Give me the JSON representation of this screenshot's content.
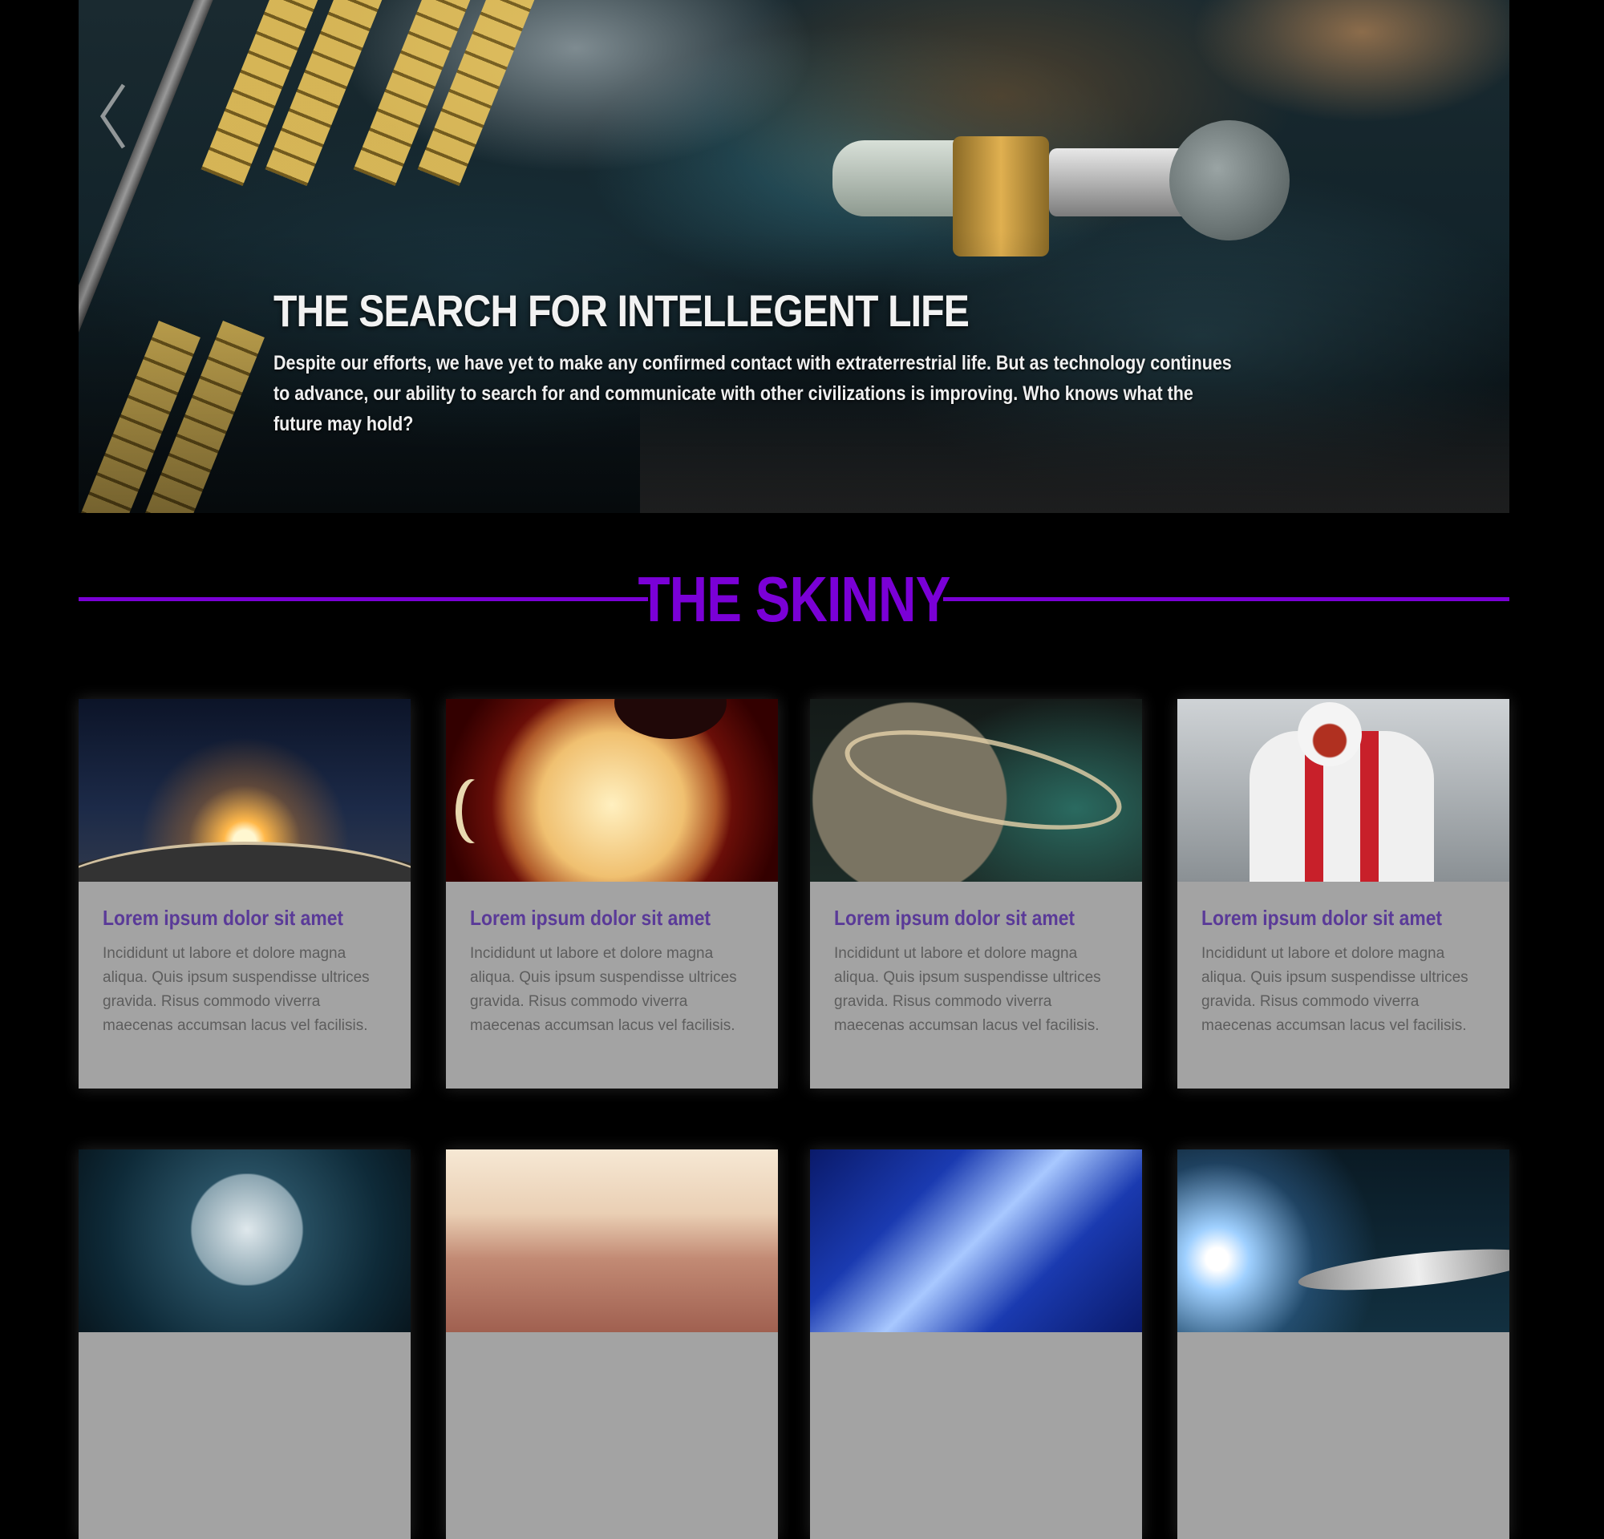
{
  "hero": {
    "title": "THE SEARCH FOR INTELLEGENT LIFE",
    "text": "Despite our efforts, we have yet to make any confirmed contact with extraterrestrial life. But as technology continues to advance, our ability to search for and communicate with other civilizations is improving. Who knows what the future may hold?",
    "prev_icon": "chevron-left-icon"
  },
  "section": {
    "title": "THE SKINNY",
    "accent_color": "#7a00d6"
  },
  "cards": [
    {
      "title": "Lorem ipsum dolor sit amet",
      "text": "Incididunt ut labore et dolore magna aliqua. Quis ipsum suspendisse ultrices gravida. Risus commodo viverra maecenas accumsan lacus vel facilisis."
    },
    {
      "title": "Lorem ipsum dolor sit amet",
      "text": "Incididunt ut labore et dolore magna aliqua. Quis ipsum suspendisse ultrices gravida. Risus commodo viverra maecenas accumsan lacus vel facilisis."
    },
    {
      "title": "Lorem ipsum dolor sit amet",
      "text": "Incididunt ut labore et dolore magna aliqua. Quis ipsum suspendisse ultrices gravida. Risus commodo viverra maecenas accumsan lacus vel facilisis."
    },
    {
      "title": "Lorem ipsum dolor sit amet",
      "text": "Incididunt ut labore et dolore magna aliqua. Quis ipsum suspendisse ultrices gravida. Risus commodo viverra maecenas accumsan lacus vel facilisis."
    }
  ]
}
